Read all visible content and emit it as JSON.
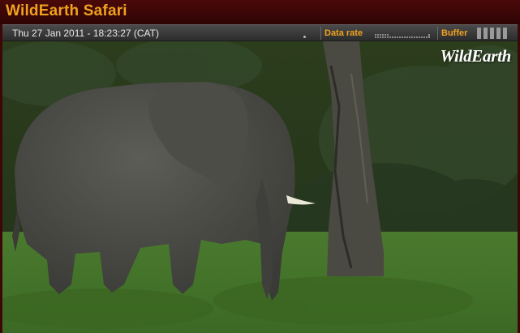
{
  "app": {
    "title": "WildEarth Safari"
  },
  "status_bar": {
    "timestamp": "Thu 27 Jan 2011 - 18:23:27 (CAT)",
    "data_rate_label": "Data rate",
    "buffer_label": "Buffer",
    "buffer_level": 1.0
  },
  "video": {
    "watermark": "WildEarth"
  },
  "colors": {
    "accent": "#f0a21e",
    "title_bar": "#3d0707",
    "status_bar": "#3a3a3a"
  }
}
